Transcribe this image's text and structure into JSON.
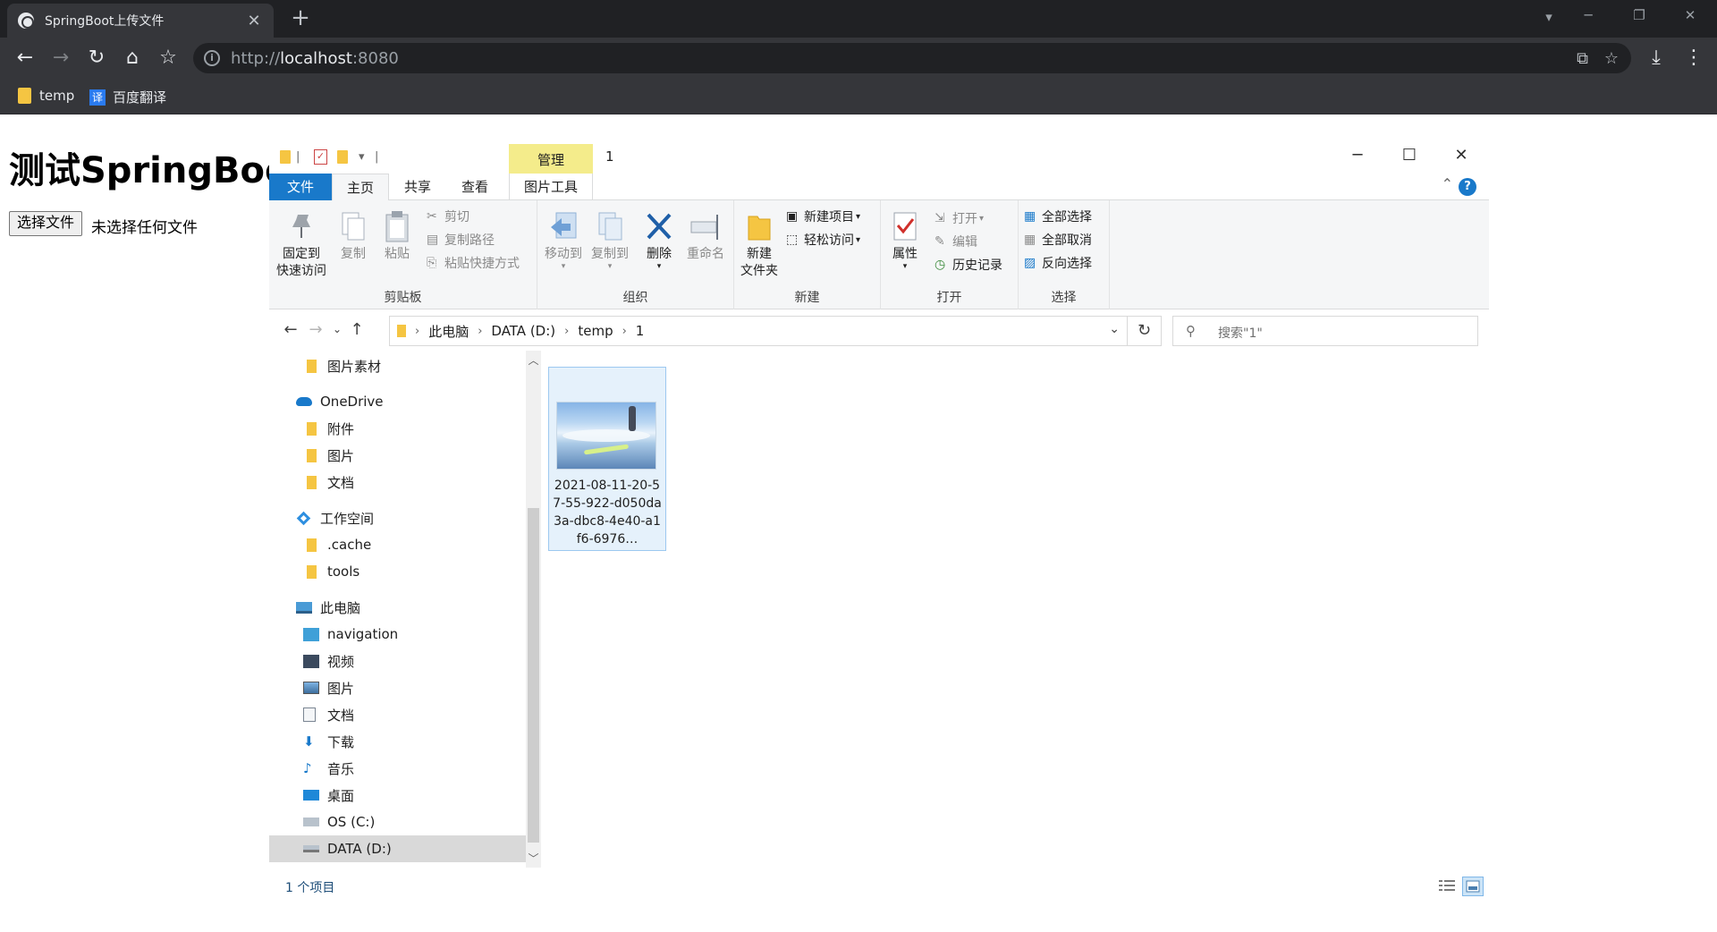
{
  "browser": {
    "tab_title": "SpringBoot上传文件",
    "url_scheme": "http://",
    "url_host": "localhost",
    "url_port": ":8080",
    "bookmarks": [
      {
        "label": "temp",
        "icon": "folder-icon"
      },
      {
        "label": "百度翻译",
        "icon": "translate-icon",
        "badge": "译"
      }
    ]
  },
  "page": {
    "heading": "测试SpringBoot",
    "file_button": "选择文件",
    "file_status": "未选择任何文件"
  },
  "explorer": {
    "window_title": "1",
    "manage_tab": "管理",
    "ribbon_tabs": [
      "文件",
      "主页",
      "共享",
      "查看",
      "图片工具"
    ],
    "groups": {
      "clipboard": {
        "label": "剪贴板",
        "pin": "固定到\n快速访问",
        "copy": "复制",
        "paste": "粘贴",
        "cut": "剪切",
        "copy_path": "复制路径",
        "paste_shortcut": "粘贴快捷方式"
      },
      "organize": {
        "label": "组织",
        "move_to": "移动到",
        "copy_to": "复制到",
        "delete": "删除",
        "rename": "重命名"
      },
      "new": {
        "label": "新建",
        "new_folder": "新建\n文件夹",
        "new_item": "新建项目",
        "easy_access": "轻松访问"
      },
      "open": {
        "label": "打开",
        "properties": "属性",
        "open": "打开",
        "edit": "编辑",
        "history": "历史记录"
      },
      "select": {
        "label": "选择",
        "select_all": "全部选择",
        "select_none": "全部取消",
        "invert": "反向选择"
      }
    },
    "address": [
      "此电脑",
      "DATA (D:)",
      "temp",
      "1"
    ],
    "search_placeholder": "搜索\"1\"",
    "nav_items": [
      {
        "label": "图片素材",
        "icon": "folder-icon",
        "indent": 2
      },
      {
        "label": "OneDrive",
        "icon": "onedrive-icon",
        "indent": 1
      },
      {
        "label": "附件",
        "icon": "folder-icon",
        "indent": 2
      },
      {
        "label": "图片",
        "icon": "folder-icon",
        "indent": 2
      },
      {
        "label": "文档",
        "icon": "folder-icon",
        "indent": 2
      },
      {
        "label": "工作空间",
        "icon": "workspace-icon",
        "indent": 1
      },
      {
        "label": ".cache",
        "icon": "folder-icon",
        "indent": 2
      },
      {
        "label": "tools",
        "icon": "folder-icon",
        "indent": 2
      },
      {
        "label": "此电脑",
        "icon": "computer-icon",
        "indent": 1
      },
      {
        "label": "navigation",
        "icon": "3d-objects-icon",
        "indent": 2
      },
      {
        "label": "视频",
        "icon": "video-icon",
        "indent": 2
      },
      {
        "label": "图片",
        "icon": "pictures-icon",
        "indent": 2
      },
      {
        "label": "文档",
        "icon": "documents-icon",
        "indent": 2
      },
      {
        "label": "下载",
        "icon": "download-icon",
        "indent": 2
      },
      {
        "label": "音乐",
        "icon": "music-icon",
        "indent": 2
      },
      {
        "label": "桌面",
        "icon": "desktop-icon",
        "indent": 2
      },
      {
        "label": "OS (C:)",
        "icon": "windows-drive-icon",
        "indent": 2
      },
      {
        "label": "DATA (D:)",
        "icon": "drive-icon",
        "indent": 2,
        "selected": true
      }
    ],
    "file": {
      "name": "2021-08-11-20-57-55-922-d050da3a-dbc8-4e40-a1f6-6976…"
    },
    "status_count": "1 个项目"
  }
}
